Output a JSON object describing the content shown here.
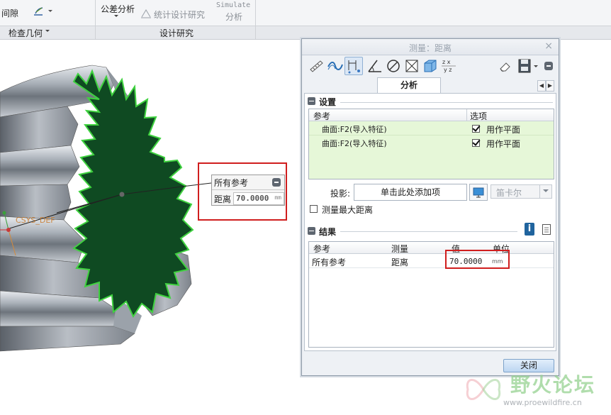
{
  "ribbon": {
    "partial_top_left": "间隙",
    "partial_top_right": "",
    "inspect_geometry_label": "检查几何",
    "tolerance_analysis": "公差分析",
    "stat_design": "统计设计研究",
    "simulate_line1": "Simulate",
    "simulate_line2": "分析",
    "design_study_label": "设计研究"
  },
  "callout": {
    "header": "所有参考",
    "label": "距离",
    "value": "70.0000",
    "unit": "mm"
  },
  "canvas": {
    "csys_label": "CSYS_DEF",
    "gear_color": "#0f4a22"
  },
  "dialog": {
    "title": "测量：距离",
    "close_x": "×",
    "tab": "分析",
    "setup": {
      "title": "设置",
      "col_ref": "参考",
      "col_option": "选项",
      "rows": [
        {
          "ref": "曲面:F2(导入特征)",
          "option": "用作平面",
          "checked": true
        },
        {
          "ref": "曲面:F2(导入特征)",
          "option": "用作平面",
          "checked": true
        }
      ],
      "projection_label": "投影:",
      "projection_placeholder": "单击此处添加项",
      "coord_select": "笛卡尔",
      "max_distance_label": "测量最大距离"
    },
    "results": {
      "title": "结果",
      "col_ref": "参考",
      "col_measure": "测量",
      "col_value": "值",
      "col_unit": "单位",
      "rows": [
        {
          "ref": "所有参考",
          "measure": "距离",
          "value": "70.0000",
          "unit": "mm"
        }
      ]
    },
    "close_button": "关闭"
  },
  "watermark": {
    "title": "野火论坛",
    "url": "www.proewildfire.cn"
  },
  "colors": {
    "highlight_red": "#d01e1e",
    "setup_green": "#e6f7d8"
  }
}
